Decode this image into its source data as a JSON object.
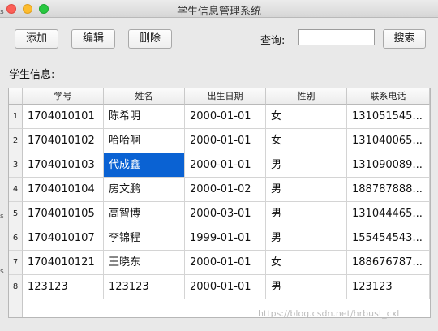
{
  "window": {
    "title": "学生信息管理系统"
  },
  "toolbar": {
    "add_label": "添加",
    "edit_label": "编辑",
    "delete_label": "删除",
    "query_label": "查询:",
    "search_value": "",
    "search_label": "搜索"
  },
  "section": {
    "label": "学生信息:"
  },
  "table": {
    "columns": [
      "学号",
      "姓名",
      "出生日期",
      "性别",
      "联系电话"
    ],
    "selected": {
      "row": 2,
      "col": 1
    },
    "rows": [
      {
        "num": "1",
        "cells": [
          "1704010101",
          "陈希明",
          "2000-01-01",
          "女",
          "131051545..."
        ]
      },
      {
        "num": "2",
        "cells": [
          "1704010102",
          "哈哈啊",
          "2000-01-01",
          "女",
          "131040065..."
        ]
      },
      {
        "num": "3",
        "cells": [
          "1704010103",
          "代成鑫",
          "2000-01-01",
          "男",
          "131090089..."
        ]
      },
      {
        "num": "4",
        "cells": [
          "1704010104",
          "房文鹏",
          "2000-01-02",
          "男",
          "188787888..."
        ]
      },
      {
        "num": "5",
        "cells": [
          "1704010105",
          "高智博",
          "2000-03-01",
          "男",
          "131044465..."
        ]
      },
      {
        "num": "6",
        "cells": [
          "1704010107",
          "李锦程",
          "1999-01-01",
          "男",
          "155454543..."
        ]
      },
      {
        "num": "7",
        "cells": [
          "1704010121",
          "王晓东",
          "2000-01-01",
          "女",
          "188676787..."
        ]
      },
      {
        "num": "8",
        "cells": [
          "123123",
          "123123",
          "2000-01-01",
          "男",
          "123123"
        ]
      }
    ]
  },
  "watermark": "https://blog.csdn.net/hrbust_cxl",
  "edge_fragments": [
    "s",
    "s",
    "s"
  ],
  "icons": {
    "close": "close-icon",
    "minimize": "minimize-icon",
    "maximize": "maximize-icon"
  },
  "colors": {
    "selection": "#0a62d3",
    "close": "#fc5f57",
    "minimize": "#fdbc2e",
    "maximize": "#28c840"
  }
}
